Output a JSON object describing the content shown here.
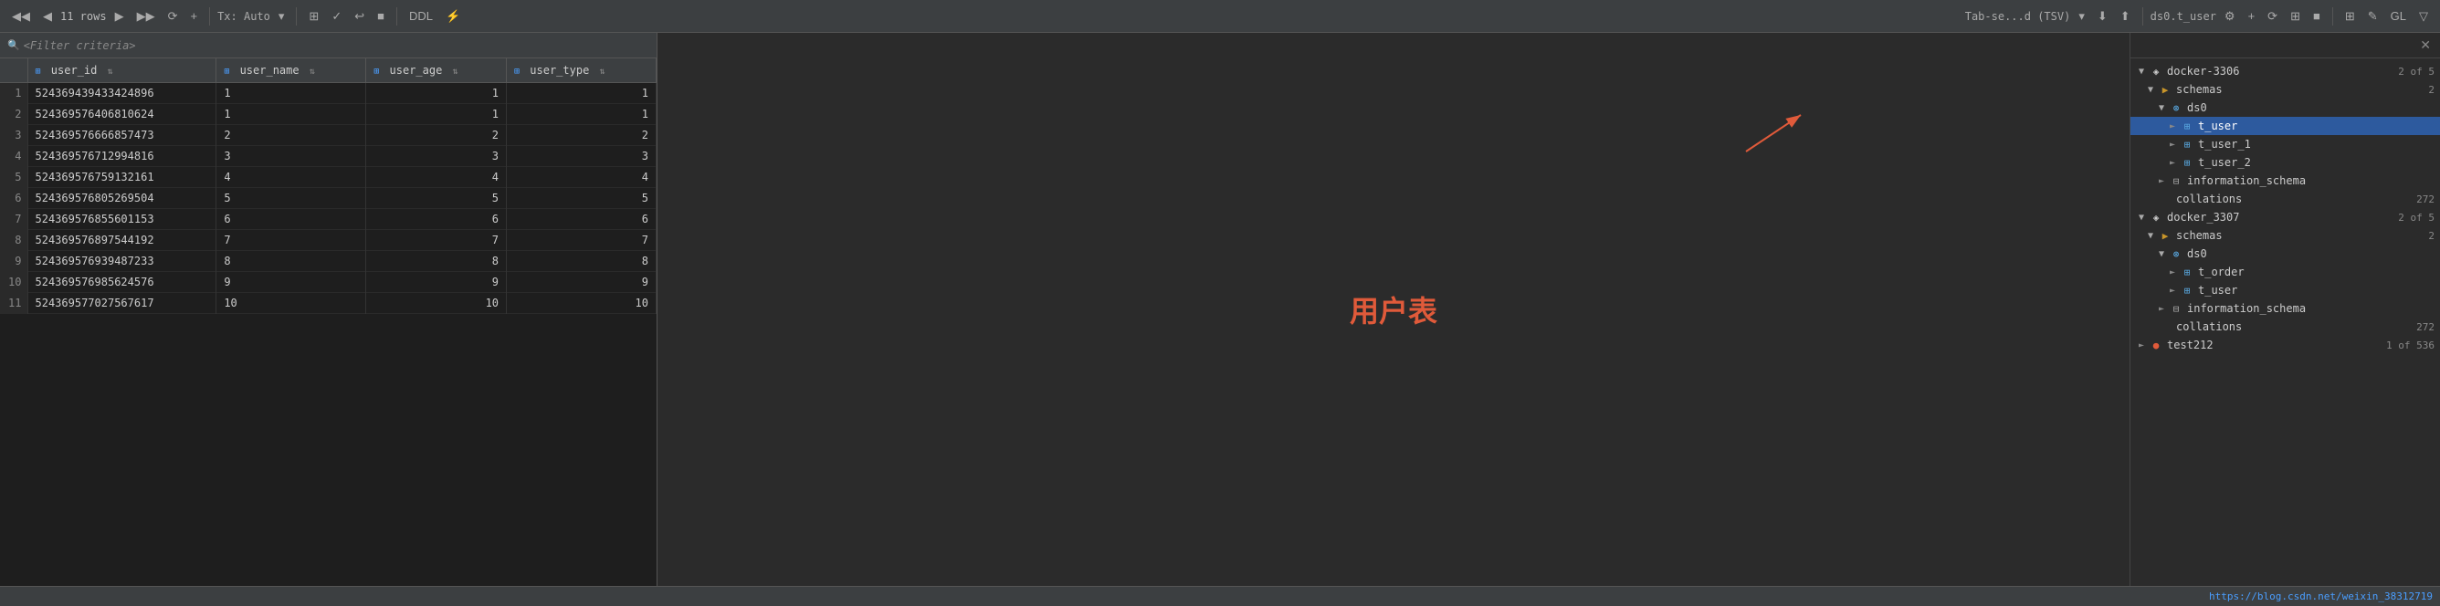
{
  "toolbar": {
    "rows_label": "11 rows",
    "tx_label": "Tx: Auto",
    "ddl_label": "DDL",
    "tab_label": "Tab-se...d (TSV)",
    "ds_label": "ds0.t_user"
  },
  "filter": {
    "placeholder": "<Filter criteria>"
  },
  "table": {
    "columns": [
      {
        "name": "user_id",
        "icon": "⊞"
      },
      {
        "name": "user_name",
        "icon": "⊞"
      },
      {
        "name": "user_age",
        "icon": "⊞"
      },
      {
        "name": "user_type",
        "icon": "⊞"
      }
    ],
    "rows": [
      {
        "num": "1",
        "user_id": "524369439433424896",
        "user_name": "1",
        "user_age": "1",
        "user_type": "1"
      },
      {
        "num": "2",
        "user_id": "524369576406810624",
        "user_name": "1",
        "user_age": "1",
        "user_type": "1"
      },
      {
        "num": "3",
        "user_id": "524369576666857473",
        "user_name": "2",
        "user_age": "2",
        "user_type": "2"
      },
      {
        "num": "4",
        "user_id": "524369576712994816",
        "user_name": "3",
        "user_age": "3",
        "user_type": "3"
      },
      {
        "num": "5",
        "user_id": "524369576759132161",
        "user_name": "4",
        "user_age": "4",
        "user_type": "4"
      },
      {
        "num": "6",
        "user_id": "524369576805269504",
        "user_name": "5",
        "user_age": "5",
        "user_type": "5"
      },
      {
        "num": "7",
        "user_id": "524369576855601153",
        "user_name": "6",
        "user_age": "6",
        "user_type": "6"
      },
      {
        "num": "8",
        "user_id": "524369576897544192",
        "user_name": "7",
        "user_age": "7",
        "user_type": "7"
      },
      {
        "num": "9",
        "user_id": "524369576939487233",
        "user_name": "8",
        "user_age": "8",
        "user_type": "8"
      },
      {
        "num": "10",
        "user_id": "524369576985624576",
        "user_name": "9",
        "user_age": "9",
        "user_type": "9"
      },
      {
        "num": "11",
        "user_id": "524369577027567617",
        "user_name": "10",
        "user_age": "10",
        "user_type": "10"
      }
    ]
  },
  "annotation": {
    "text": "用户表"
  },
  "tree": {
    "close_btn": "✕",
    "items": [
      {
        "id": "docker3306",
        "indent": 0,
        "expand": "▼",
        "icon_type": "server",
        "label": "docker-3306",
        "badge": "2 of 5"
      },
      {
        "id": "schemas3306",
        "indent": 1,
        "expand": "▼",
        "icon_type": "folder",
        "label": "schemas",
        "badge": "2"
      },
      {
        "id": "ds0",
        "indent": 2,
        "expand": "▼",
        "icon_type": "db",
        "label": "ds0",
        "badge": ""
      },
      {
        "id": "t_user",
        "indent": 3,
        "expand": "►",
        "icon_type": "table",
        "label": "t_user",
        "badge": "",
        "selected": true
      },
      {
        "id": "t_user_1",
        "indent": 3,
        "expand": "►",
        "icon_type": "table",
        "label": "t_user_1",
        "badge": ""
      },
      {
        "id": "t_user_2",
        "indent": 3,
        "expand": "►",
        "icon_type": "table",
        "label": "t_user_2",
        "badge": ""
      },
      {
        "id": "info_schema3306",
        "indent": 2,
        "expand": "►",
        "icon_type": "schema",
        "label": "information_schema",
        "badge": ""
      },
      {
        "id": "collations3306",
        "indent": 1,
        "expand": "",
        "icon_type": "none",
        "label": "collations",
        "badge": "272"
      },
      {
        "id": "docker3307",
        "indent": 0,
        "expand": "▼",
        "icon_type": "server",
        "label": "docker_3307",
        "badge": "2 of 5"
      },
      {
        "id": "schemas3307",
        "indent": 1,
        "expand": "▼",
        "icon_type": "folder",
        "label": "schemas",
        "badge": "2"
      },
      {
        "id": "ds0_3307",
        "indent": 2,
        "expand": "▼",
        "icon_type": "db",
        "label": "ds0",
        "badge": ""
      },
      {
        "id": "t_order",
        "indent": 3,
        "expand": "►",
        "icon_type": "table",
        "label": "t_order",
        "badge": ""
      },
      {
        "id": "t_user_3307",
        "indent": 3,
        "expand": "►",
        "icon_type": "table",
        "label": "t_user",
        "badge": ""
      },
      {
        "id": "info_schema3307",
        "indent": 2,
        "expand": "►",
        "icon_type": "schema",
        "label": "information_schema",
        "badge": ""
      },
      {
        "id": "collations3307",
        "indent": 1,
        "expand": "",
        "icon_type": "none",
        "label": "collations",
        "badge": "272"
      },
      {
        "id": "test212",
        "indent": 0,
        "expand": "►",
        "icon_type": "server_red",
        "label": "test212",
        "badge": "1 of 536"
      }
    ]
  },
  "status": {
    "link_text": "https://blog.csdn.net/weixin_38312719"
  }
}
